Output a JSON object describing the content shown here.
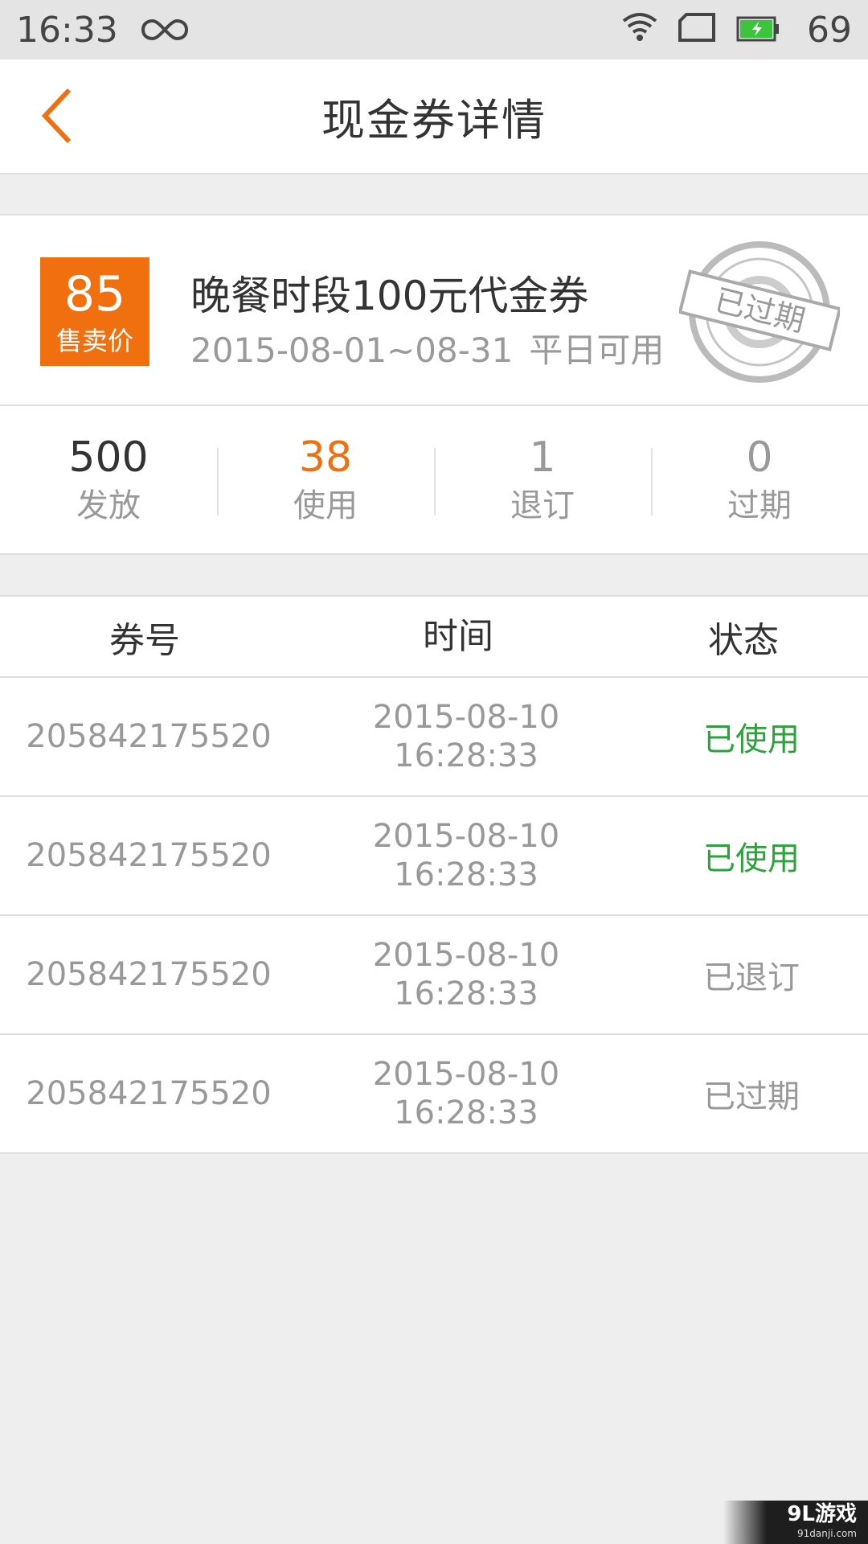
{
  "status_bar": {
    "time": "16:33",
    "battery": "69"
  },
  "header": {
    "title": "现金券详情"
  },
  "coupon": {
    "price": "85",
    "price_label": "售卖价",
    "name": "晚餐时段100元代金券",
    "date_range": "2015-08-01~08-31",
    "availability": "平日可用",
    "stamp_text": "已过期"
  },
  "stats": [
    {
      "value": "500",
      "label": "发放"
    },
    {
      "value": "38",
      "label": "使用"
    },
    {
      "value": "1",
      "label": "退订"
    },
    {
      "value": "0",
      "label": "过期"
    }
  ],
  "table": {
    "headers": {
      "id": "券号",
      "time": "时间",
      "status": "状态"
    },
    "rows": [
      {
        "id": "205842175520",
        "date": "2015-08-10",
        "time": "16:28:33",
        "status": "已使用"
      },
      {
        "id": "205842175520",
        "date": "2015-08-10",
        "time": "16:28:33",
        "status": "已使用"
      },
      {
        "id": "205842175520",
        "date": "2015-08-10",
        "time": "16:28:33",
        "status": "已退订"
      },
      {
        "id": "205842175520",
        "date": "2015-08-10",
        "time": "16:28:33",
        "status": "已过期"
      }
    ]
  },
  "watermark": {
    "main": "9L游戏",
    "sub": "91danji.com"
  },
  "colors": {
    "accent": "#f07010",
    "used": "#2aa33a",
    "muted": "#999999"
  }
}
